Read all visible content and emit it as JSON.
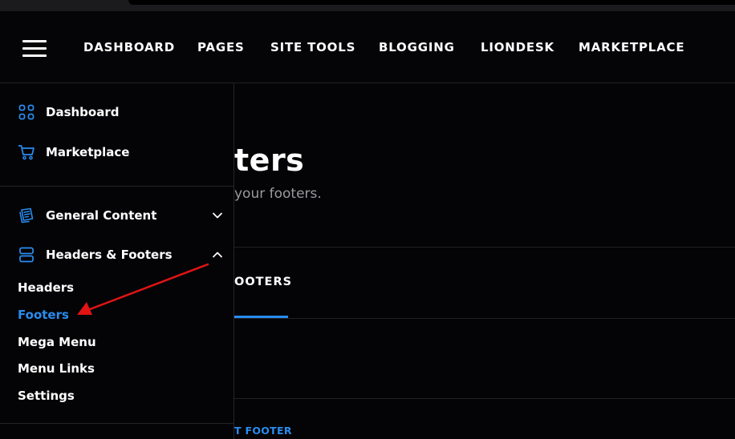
{
  "topnav": {
    "items": [
      "DASHBOARD",
      "PAGES",
      "SITE TOOLS",
      "BLOGGING",
      "LIONDESK",
      "MARKETPLACE"
    ]
  },
  "sidebar": {
    "primary": [
      {
        "label": "Dashboard",
        "icon": "grid-icon"
      },
      {
        "label": "Marketplace",
        "icon": "cart-icon"
      }
    ],
    "sections": [
      {
        "label": "General Content",
        "icon": "documents-icon",
        "expanded": false
      },
      {
        "label": "Headers & Footers",
        "icon": "layout-rows-icon",
        "expanded": true
      }
    ],
    "subitems": [
      "Headers",
      "Footers",
      "Mega Menu",
      "Menu Links",
      "Settings"
    ],
    "active_subitem": "Footers"
  },
  "main": {
    "title_partial": "ters",
    "subtitle_partial": "your footers.",
    "tab_label_partial": "OOTERS",
    "add_button_partial": "T FOOTER"
  },
  "colors": {
    "accent": "#2a8cf0",
    "annotation_arrow": "#e01414",
    "background": "#040406"
  }
}
